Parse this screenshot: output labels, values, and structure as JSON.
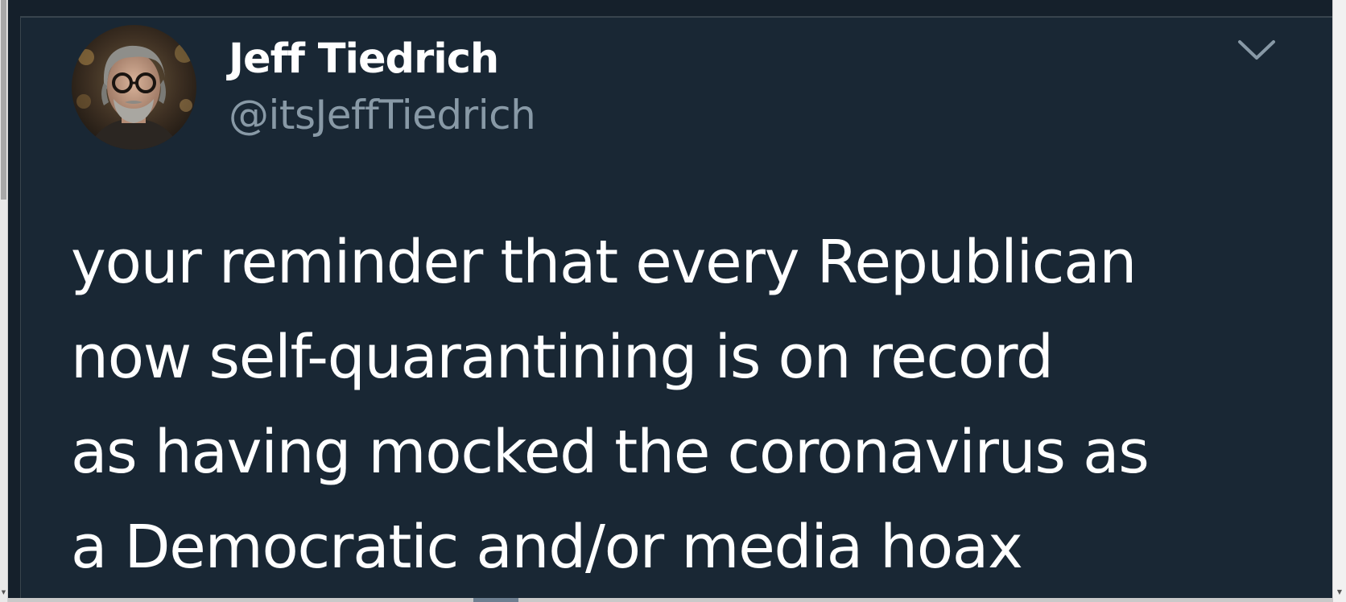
{
  "tweet": {
    "display_name": "Jeff Tiedrich",
    "handle": "@itsJeffTiedrich",
    "text_lines": [
      "your reminder that every Republican",
      "now self-quarantining is on record",
      "as having mocked the coronavirus as",
      "a Democratic and/or media hoax"
    ]
  },
  "icons": {
    "menu_caret": "chevron-down-icon",
    "avatar": "avatar-photo"
  },
  "colors": {
    "page_background": "#15202b",
    "card_background": "#192734",
    "text_primary": "#ffffff",
    "text_secondary": "#8899a6",
    "border": "#38444d"
  }
}
